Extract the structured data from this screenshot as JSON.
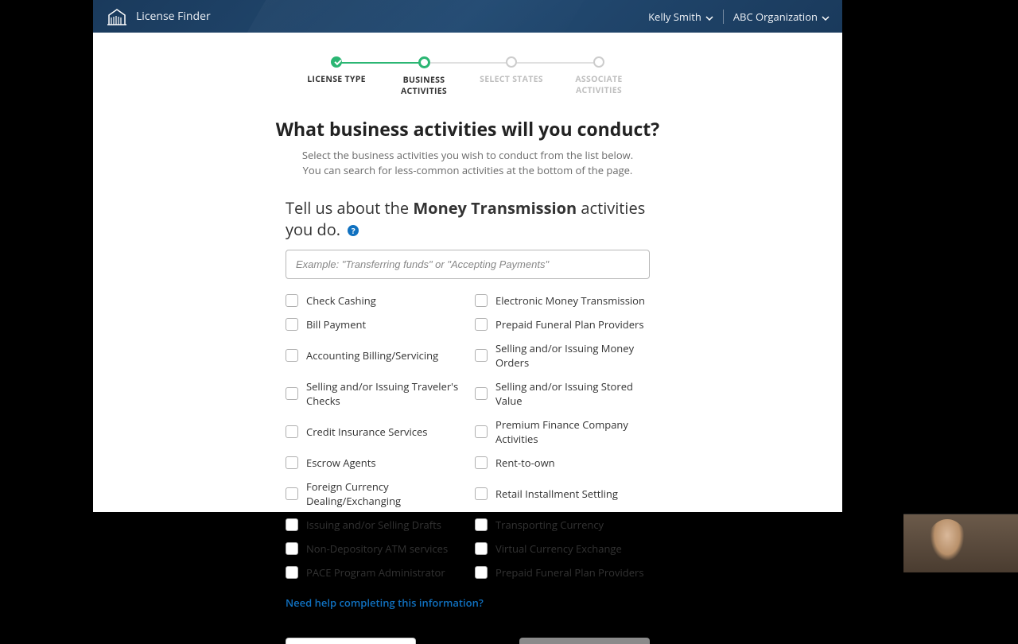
{
  "header": {
    "app_name": "License Finder",
    "user_name": "Kelly Smith",
    "org_name": "ABC Organization"
  },
  "stepper": {
    "steps": [
      {
        "label": "LICENSE TYPE",
        "state": "done"
      },
      {
        "label": "BUSINESS ACTIVITIES",
        "state": "current"
      },
      {
        "label": "SELECT STATES",
        "state": "upcoming"
      },
      {
        "label": "ASSOCIATE ACTIVITIES",
        "state": "upcoming"
      }
    ]
  },
  "heading": {
    "title": "What business activities will you conduct?",
    "sub1": "Select the business activities you wish to conduct from the list below.",
    "sub2": "You can search for less-common activities at the bottom of the page."
  },
  "prompt": {
    "prefix": "Tell us about the ",
    "bold": "Money Transmission",
    "suffix": " activities you do."
  },
  "search": {
    "placeholder": "Example: \"Transferring funds\" or \"Accepting Payments\""
  },
  "activities_left": [
    "Check Cashing",
    "Bill Payment",
    "Accounting Billing/Servicing",
    "Selling and/or Issuing Traveler's Checks",
    "Credit Insurance Services",
    "Escrow Agents",
    "Foreign Currency Dealing/Exchanging",
    "Issuing and/or Selling Drafts",
    "Non-Depository ATM services",
    "PACE Program Administrator"
  ],
  "activities_right": [
    "Electronic Money Transmission",
    "Prepaid Funeral Plan Providers",
    "Selling and/or Issuing Money Orders",
    "Selling and/or Issuing Stored Value",
    "Premium Finance Company Activities",
    "Rent-to-own",
    "Retail Installment Settling",
    "Transporting Currency",
    "Virtual Currency Exchange",
    "Prepaid Funeral Plan Providers"
  ],
  "help_link": "Need help completing this information?"
}
